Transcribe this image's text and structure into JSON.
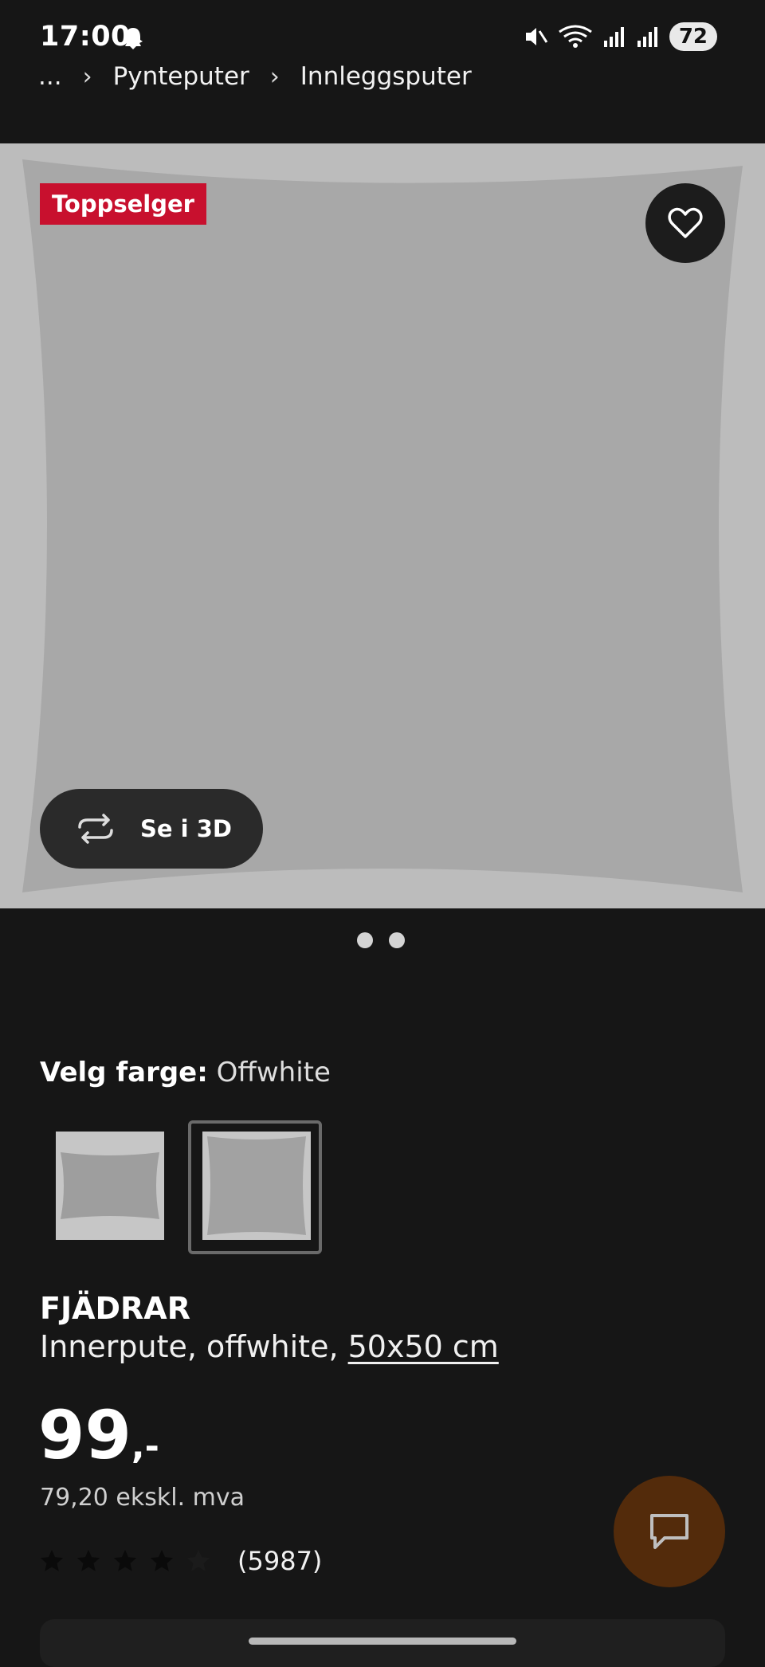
{
  "status": {
    "time": "17:00",
    "battery": "72",
    "icons": [
      "ghost-icon",
      "mute-icon",
      "wifi-icon",
      "signal-icon",
      "signal-icon"
    ]
  },
  "breadcrumb": {
    "ellipsis": "...",
    "items": [
      "Pynteputer",
      "Innleggsputer"
    ]
  },
  "gallery": {
    "badge": "Toppselger",
    "view3d_label": "Se i 3D",
    "slide_count": 2
  },
  "colors": {
    "label": "Velg farge:",
    "value": "Offwhite",
    "background": "#161616",
    "badge": "#c8102e",
    "chat": "#532b0b"
  },
  "product": {
    "name": "FJÄDRAR",
    "desc_prefix": "Innerpute, offwhite, ",
    "size": "50x50 cm"
  },
  "price": {
    "integer": "99",
    "suffix": ",-",
    "ex_vat": "79,20 ekskl. mva"
  },
  "rating": {
    "stars": 4,
    "max": 5,
    "count": "(5987)"
  }
}
